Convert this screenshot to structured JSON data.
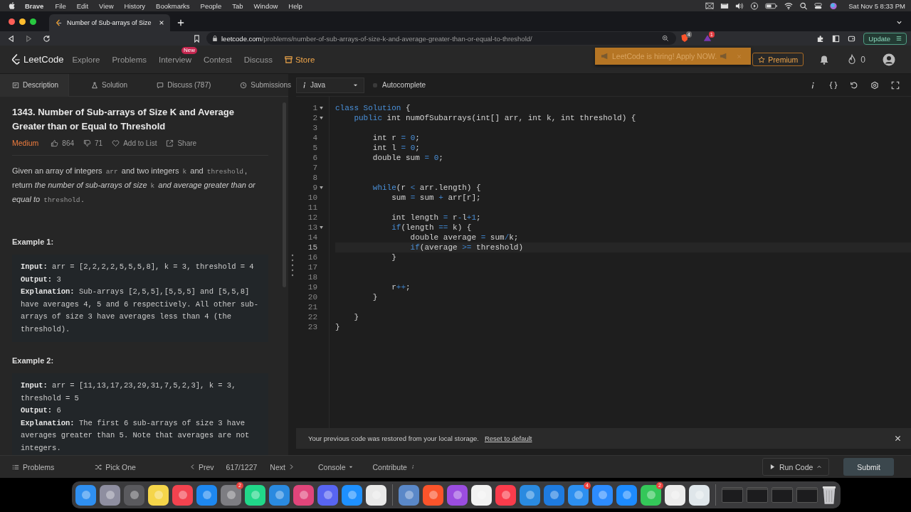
{
  "menu_bar": {
    "app": "Brave",
    "items": [
      "File",
      "Edit",
      "View",
      "History",
      "Bookmarks",
      "People",
      "Tab",
      "Window",
      "Help"
    ],
    "clock": "Sat Nov 5  8:33 PM"
  },
  "browser": {
    "tab": {
      "title": "Number of Sub-arrays of Size",
      "selected": true
    },
    "url_host": "leetcode.com",
    "url_path": "/problems/number-of-sub-arrays-of-size-k-and-average-greater-than-or-equal-to-threshold/",
    "shield_badge": "4",
    "alert_badge": "1",
    "update_button": "Update"
  },
  "nav": {
    "logo": "LeetCode",
    "links": [
      {
        "label": "Explore",
        "kind": "plain"
      },
      {
        "label": "Problems",
        "kind": "plain"
      },
      {
        "label": "Interview",
        "kind": "plain",
        "badge": "New"
      },
      {
        "label": "Contest",
        "kind": "plain"
      },
      {
        "label": "Discuss",
        "kind": "plain"
      },
      {
        "label": "Store",
        "kind": "store"
      }
    ],
    "banner": "LeetCode is hiring! Apply NOW.",
    "premium": "Premium",
    "streak": "0"
  },
  "panel_tabs": [
    {
      "label": "Description",
      "selected": true,
      "kind": "description"
    },
    {
      "label": "Solution",
      "selected": false,
      "kind": "solution"
    },
    {
      "label": "Discuss (787)",
      "selected": false,
      "kind": "discuss"
    },
    {
      "label": "Submissions",
      "selected": false,
      "kind": "submissions"
    }
  ],
  "problem": {
    "title": "1343. Number of Sub-arrays of Size K and Average Greater than or Equal to Threshold",
    "difficulty": "Medium",
    "likes": "864",
    "dislikes": "71",
    "add_to_list": "Add to List",
    "share": "Share",
    "description": [
      {
        "kind": "text",
        "text": "Given an array of integers "
      },
      {
        "kind": "code",
        "text": "arr"
      },
      {
        "kind": "text",
        "text": " and two integers "
      },
      {
        "kind": "code",
        "text": "k"
      },
      {
        "kind": "text",
        "text": " and "
      },
      {
        "kind": "code",
        "text": "threshold"
      },
      {
        "kind": "text",
        "text": ", return "
      },
      {
        "kind": "em",
        "text": "the number of sub-arrays of size "
      },
      {
        "kind": "code",
        "text": "k"
      },
      {
        "kind": "em",
        "text": " and average greater than or equal to "
      },
      {
        "kind": "code",
        "text": "threshold"
      },
      {
        "kind": "text",
        "text": "."
      }
    ],
    "examples": [
      {
        "heading": "Example 1:",
        "lines": [
          "**Input:** arr = [2,2,2,2,5,5,5,8], k = 3, threshold = 4",
          "**Output:** 3",
          "**Explanation:** Sub-arrays [2,5,5],[5,5,5] and [5,5,8] have averages 4, 5 and 6 respectively. All other sub-arrays of size 3 have averages less than 4 (the threshold)."
        ]
      },
      {
        "heading": "Example 2:",
        "lines": [
          "**Input:** arr = [11,13,17,23,29,31,7,5,2,3], k = 3, threshold = 5",
          "**Output:** 6",
          "**Explanation:** The first 6 sub-arrays of size 3 have averages greater than 5. Note that averages are not integers."
        ]
      }
    ]
  },
  "editor": {
    "language": "Java",
    "autocomplete": {
      "label": "Autocomplete",
      "on": false
    },
    "lines": [
      {
        "n": "1",
        "fold": true,
        "active": false,
        "tokens": [
          {
            "kind": "kw",
            "text": "class Solution"
          },
          {
            "kind": "p",
            "text": " {"
          }
        ]
      },
      {
        "n": "2",
        "fold": true,
        "active": false,
        "tokens": [
          {
            "kind": "kw",
            "text": "    public"
          },
          {
            "kind": "p",
            "text": " int numOfSubarrays(int[] arr, int k, int threshold) {"
          }
        ]
      },
      {
        "n": "3",
        "active": false
      },
      {
        "n": "4",
        "active": false,
        "tokens": [
          {
            "kind": "p",
            "text": "        int r "
          },
          {
            "kind": "op",
            "text": "="
          },
          {
            "kind": "num",
            "text": " 0"
          },
          {
            "kind": "p",
            "text": ";"
          }
        ]
      },
      {
        "n": "5",
        "active": false,
        "tokens": [
          {
            "kind": "p",
            "text": "        int l "
          },
          {
            "kind": "op",
            "text": "="
          },
          {
            "kind": "num",
            "text": " 0"
          },
          {
            "kind": "p",
            "text": ";"
          }
        ]
      },
      {
        "n": "6",
        "active": false,
        "tokens": [
          {
            "kind": "p",
            "text": "        double sum "
          },
          {
            "kind": "op",
            "text": "="
          },
          {
            "kind": "num",
            "text": " 0"
          },
          {
            "kind": "p",
            "text": ";"
          }
        ]
      },
      {
        "n": "7",
        "active": false
      },
      {
        "n": "8",
        "active": false
      },
      {
        "n": "9",
        "fold": true,
        "active": false,
        "tokens": [
          {
            "kind": "kw",
            "text": "        while"
          },
          {
            "kind": "p",
            "text": "(r "
          },
          {
            "kind": "op",
            "text": "<"
          },
          {
            "kind": "p",
            "text": " arr.length) {"
          }
        ]
      },
      {
        "n": "10",
        "active": false,
        "tokens": [
          {
            "kind": "p",
            "text": "            sum "
          },
          {
            "kind": "op",
            "text": "="
          },
          {
            "kind": "p",
            "text": " sum "
          },
          {
            "kind": "op",
            "text": "+"
          },
          {
            "kind": "p",
            "text": " arr[r];"
          }
        ]
      },
      {
        "n": "11",
        "active": false
      },
      {
        "n": "12",
        "active": false,
        "tokens": [
          {
            "kind": "p",
            "text": "            int length "
          },
          {
            "kind": "op",
            "text": "="
          },
          {
            "kind": "p",
            "text": " r"
          },
          {
            "kind": "op",
            "text": "-"
          },
          {
            "kind": "p",
            "text": "l"
          },
          {
            "kind": "op",
            "text": "+"
          },
          {
            "kind": "num",
            "text": "1"
          },
          {
            "kind": "p",
            "text": ";"
          }
        ]
      },
      {
        "n": "13",
        "fold": true,
        "active": false,
        "tokens": [
          {
            "kind": "kw",
            "text": "            if"
          },
          {
            "kind": "p",
            "text": "(length "
          },
          {
            "kind": "op",
            "text": "=="
          },
          {
            "kind": "p",
            "text": " k) {"
          }
        ]
      },
      {
        "n": "14",
        "active": false,
        "tokens": [
          {
            "kind": "p",
            "text": "                double average "
          },
          {
            "kind": "op",
            "text": "="
          },
          {
            "kind": "p",
            "text": " sum"
          },
          {
            "kind": "op",
            "text": "/"
          },
          {
            "kind": "p",
            "text": "k;"
          }
        ]
      },
      {
        "n": "15",
        "active": true,
        "tokens": [
          {
            "kind": "kw",
            "text": "                if"
          },
          {
            "kind": "p",
            "text": "(average "
          },
          {
            "kind": "op",
            "text": ">="
          },
          {
            "kind": "p",
            "text": " threshold)"
          }
        ]
      },
      {
        "n": "16",
        "active": false,
        "tokens": [
          {
            "kind": "p",
            "text": "            }"
          }
        ]
      },
      {
        "n": "17",
        "active": false
      },
      {
        "n": "18",
        "active": false
      },
      {
        "n": "19",
        "active": false,
        "tokens": [
          {
            "kind": "p",
            "text": "            r"
          },
          {
            "kind": "op",
            "text": "++"
          },
          {
            "kind": "p",
            "text": ";"
          }
        ]
      },
      {
        "n": "20",
        "active": false,
        "tokens": [
          {
            "kind": "p",
            "text": "        }"
          }
        ]
      },
      {
        "n": "21",
        "active": false
      },
      {
        "n": "22",
        "active": false,
        "tokens": [
          {
            "kind": "p",
            "text": "    }"
          }
        ]
      },
      {
        "n": "23",
        "active": false,
        "tokens": [
          {
            "kind": "p",
            "text": "}"
          }
        ]
      }
    ]
  },
  "notice": {
    "text": "Your previous code was restored from your local storage.",
    "link": "Reset to default"
  },
  "bottom_bar": {
    "problems": "Problems",
    "pick_one": "Pick One",
    "prev": "Prev",
    "position": "617/1227",
    "next": "Next",
    "console": "Console",
    "contribute": "Contribute",
    "run": "Run Code",
    "submit": "Submit"
  },
  "dock": [
    {
      "kind": "app",
      "color": "#2f8ff0"
    },
    {
      "kind": "app",
      "color": "#8e8ea0"
    },
    {
      "kind": "app",
      "color": "#5a5a5e"
    },
    {
      "kind": "app",
      "color": "#f5d54a"
    },
    {
      "kind": "app",
      "color": "#f3434f"
    },
    {
      "kind": "app",
      "color": "#1e88f0"
    },
    {
      "kind": "app",
      "color": "#7d7d82",
      "badge": "2"
    },
    {
      "kind": "app",
      "color": "#21d789"
    },
    {
      "kind": "app",
      "color": "#2a8ae0"
    },
    {
      "kind": "app",
      "color": "#e0457b"
    },
    {
      "kind": "app",
      "color": "#5865f2"
    },
    {
      "kind": "app",
      "color": "#1e90ff"
    },
    {
      "kind": "app",
      "color": "#e9e9e9"
    },
    {
      "kind": "separator"
    },
    {
      "kind": "app",
      "color": "#5a88c8"
    },
    {
      "kind": "app",
      "color": "#fb542b"
    },
    {
      "kind": "app",
      "color": "#9b4de0"
    },
    {
      "kind": "app",
      "color": "#f2f2f2"
    },
    {
      "kind": "app",
      "color": "#fa3c4c"
    },
    {
      "kind": "app",
      "color": "#2a8ae0"
    },
    {
      "kind": "app",
      "color": "#1e7be0"
    },
    {
      "kind": "app",
      "color": "#2c8ff0",
      "badge": "4"
    },
    {
      "kind": "app",
      "color": "#2d8cff"
    },
    {
      "kind": "app",
      "color": "#1d8bff"
    },
    {
      "kind": "app",
      "color": "#34c759",
      "badge": "2"
    },
    {
      "kind": "app",
      "color": "#ececec"
    },
    {
      "kind": "app",
      "color": "#dfe6ea"
    },
    {
      "kind": "separator"
    },
    {
      "kind": "window"
    },
    {
      "kind": "window"
    },
    {
      "kind": "window"
    },
    {
      "kind": "window"
    },
    {
      "kind": "trash"
    }
  ]
}
